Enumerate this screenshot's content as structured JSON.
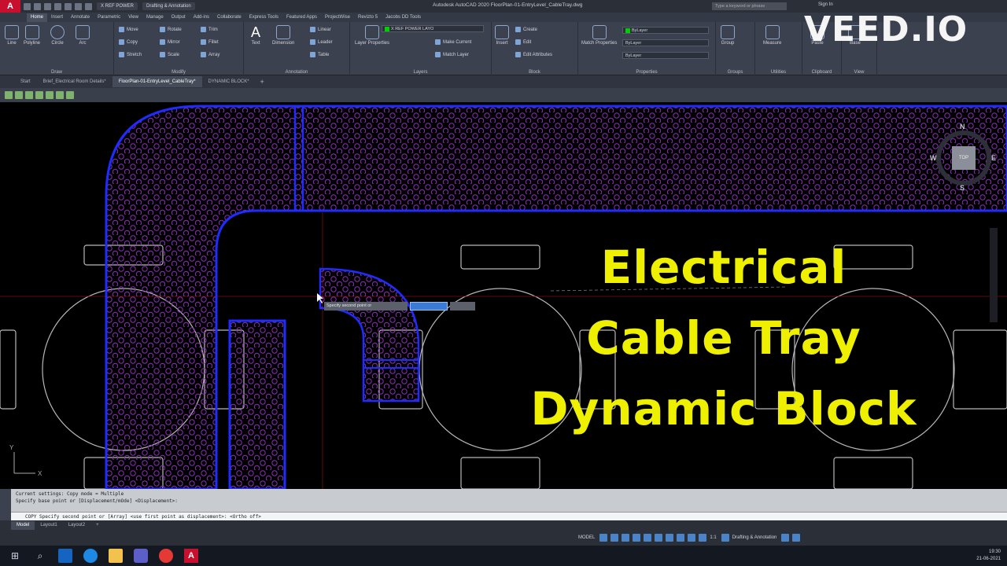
{
  "app": {
    "logo": "A",
    "workspace": "Drafting & Annotation",
    "layer_pill": "X REF POWER",
    "window_title": "Autodesk AutoCAD 2020   FloorPlan-01-EntryLevel_CableTray.dwg",
    "search_placeholder": "Type a keyword or phrase",
    "sign_in": "Sign In"
  },
  "ribbon_tabs": [
    "Home",
    "Insert",
    "Annotate",
    "Parametric",
    "View",
    "Manage",
    "Output",
    "Add-ins",
    "Collaborate",
    "Express Tools",
    "Featured Apps",
    "ProjectWise",
    "Revizto 5",
    "Jacobs DD Tools"
  ],
  "ribbon": {
    "draw": {
      "label": "Draw",
      "tools": [
        "Line",
        "Polyline",
        "Circle",
        "Arc"
      ]
    },
    "modify": {
      "label": "Modify",
      "tools": [
        "Move",
        "Rotate",
        "Trim",
        "Copy",
        "Mirror",
        "Fillet",
        "Stretch",
        "Scale",
        "Array"
      ]
    },
    "annotation": {
      "label": "Annotation",
      "tools": [
        "Text",
        "Dimension",
        "Linear",
        "Leader",
        "Table"
      ]
    },
    "layers": {
      "label": "Layers",
      "tools": [
        "Layer Properties",
        "Make Current",
        "Match Layer"
      ],
      "current": "X REF POWER LAYO"
    },
    "block": {
      "label": "Block",
      "tools": [
        "Insert",
        "Create",
        "Edit",
        "Edit Attributes"
      ]
    },
    "properties": {
      "label": "Properties",
      "tools": [
        "Match Properties"
      ],
      "bylayer": "ByLayer"
    },
    "groups": {
      "label": "Groups",
      "tools": [
        "Group"
      ]
    },
    "utilities": {
      "label": "Utilities",
      "tools": [
        "Measure"
      ]
    },
    "clipboard": {
      "label": "Clipboard",
      "tools": [
        "Paste"
      ]
    },
    "view": {
      "label": "View",
      "tools": [
        "Base"
      ]
    }
  },
  "doc_tabs": [
    "Start",
    "Brief_Electrical Room Details*",
    "FloorPlan-01-EntryLevel_CableTray*",
    "DYNAMIC BLOCK*"
  ],
  "viewcube": {
    "top": "TOP",
    "n": "N",
    "s": "S",
    "e": "E",
    "w": "W"
  },
  "ucs": {
    "y": "Y",
    "x": "X"
  },
  "dynamic_input": {
    "prompt": "Specify second point or",
    "x": "",
    "y": ""
  },
  "headline": [
    "Electrical",
    "Cable Tray",
    "Dynamic Block"
  ],
  "watermark": "VEED.IO",
  "command": {
    "history": [
      "Current settings:  Copy mode = Multiple",
      "Specify base point or [Displacement/mOde] <Displacement>:"
    ],
    "input": "COPY Specify second point or [Array] <use first point as displacement>:  <Ortho off>"
  },
  "layout_tabs": [
    "Model",
    "Layout1",
    "Layout2"
  ],
  "status": {
    "model": "MODEL",
    "scale": "1:1",
    "workspace": "Drafting & Annotation"
  },
  "taskbar": {
    "time": "19:30",
    "date": "21-06-2021"
  },
  "colors": {
    "tray_outline": "#1f2bff",
    "tray_holes": "#8a2fb5",
    "headline": "#eef000",
    "ribbon": "#3c4150"
  }
}
